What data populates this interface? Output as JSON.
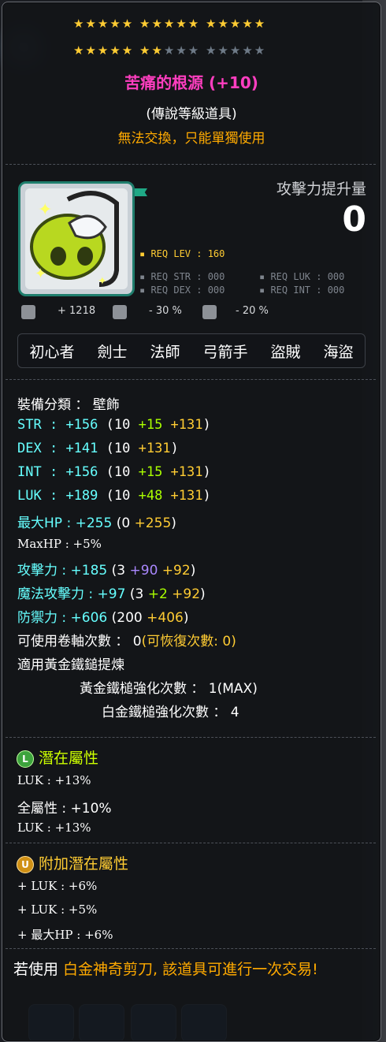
{
  "stars": {
    "row1": "★★★★★ ★★★★★ ★★★★★",
    "row2_on": "★★★★★ ★★",
    "row2_off": "★★★ ★★★★★"
  },
  "item": {
    "name": "苦痛的根源 (+10)",
    "grade": "(傳說等級道具)",
    "trade_note": "無法交換，只能單獨使用"
  },
  "attack_gain": {
    "label": "攻擊力提升量",
    "value": "0"
  },
  "requirements": {
    "lev": "▪ REQ LEV : 160",
    "str": "▪ REQ STR : 000",
    "luk": "▪ REQ LUK : 000",
    "dex": "▪ REQ DEX : 000",
    "int": "▪ REQ INT : 000"
  },
  "small_stats": {
    "combat_power": "+ 1218",
    "reduction_1": "- 30 %",
    "reduction_2": "- 20 %"
  },
  "jobs": [
    "初心者",
    "劍士",
    "法師",
    "弓箭手",
    "盜賊",
    "海盜"
  ],
  "stats": {
    "category": "裝備分類 ： 壁飾",
    "str": {
      "label": "STR",
      "sep": " : ",
      "total": "+156",
      "base": "(10 ",
      "a": "+15",
      "b": " +131",
      "end": ")"
    },
    "dex": {
      "label": "DEX",
      "sep": " : ",
      "total": "+141",
      "base": "(10 ",
      "b": "+131",
      "end": ")"
    },
    "int": {
      "label": "INT",
      "sep": " : ",
      "total": "+156",
      "base": "(10 ",
      "a": "+15",
      "b": " +131",
      "end": ")"
    },
    "luk": {
      "label": "LUK",
      "sep": " : ",
      "total": "+189",
      "base": "(10 ",
      "a": "+48",
      "b": " +131",
      "end": ")"
    },
    "maxhp": {
      "label": "最大HP",
      "sep": " : ",
      "total": "+255",
      "base": "(0 ",
      "b": "+255",
      "end": ")"
    },
    "maxhp_pct": "MaxHP : +5%",
    "atk": {
      "label": "攻擊力",
      "sep": " : ",
      "total": "+185",
      "base": "(3 ",
      "a": "+90",
      "b": " +92",
      "end": ")"
    },
    "matk": {
      "label": "魔法攻擊力",
      "sep": " : ",
      "total": "+97",
      "base": "(3 ",
      "a": "+2",
      "b": " +92",
      "end": ")"
    },
    "def": {
      "label": "防禦力",
      "sep": " : ",
      "total": "+606",
      "base": "(200 ",
      "b": "+406",
      "end": ")"
    },
    "upgrades_label": "可使用卷軸次數 ： 0",
    "upgrades_restore": "(可恢復次數: 0)",
    "hammer": "適用黃金鐵鎚提煉",
    "gold_hammer": "黃金鐵槌強化次數 ： 1(MAX)",
    "plat_hammer": "白金鐵槌強化次數 ： 4"
  },
  "potential": {
    "label": "潛在屬性",
    "badge": "L",
    "lines": [
      "LUK : +13%",
      "全屬性 : +10%",
      "LUK : +13%"
    ]
  },
  "additional": {
    "label": "附加潛在屬性",
    "badge": "U",
    "lines": [
      "+ LUK : +6%",
      "+ LUK : +5%",
      "+ 最大HP : +6%"
    ]
  },
  "footer": {
    "prefix": "若使用 ",
    "highlight": "白金神奇剪刀, 該道具可進行一次交易!"
  }
}
